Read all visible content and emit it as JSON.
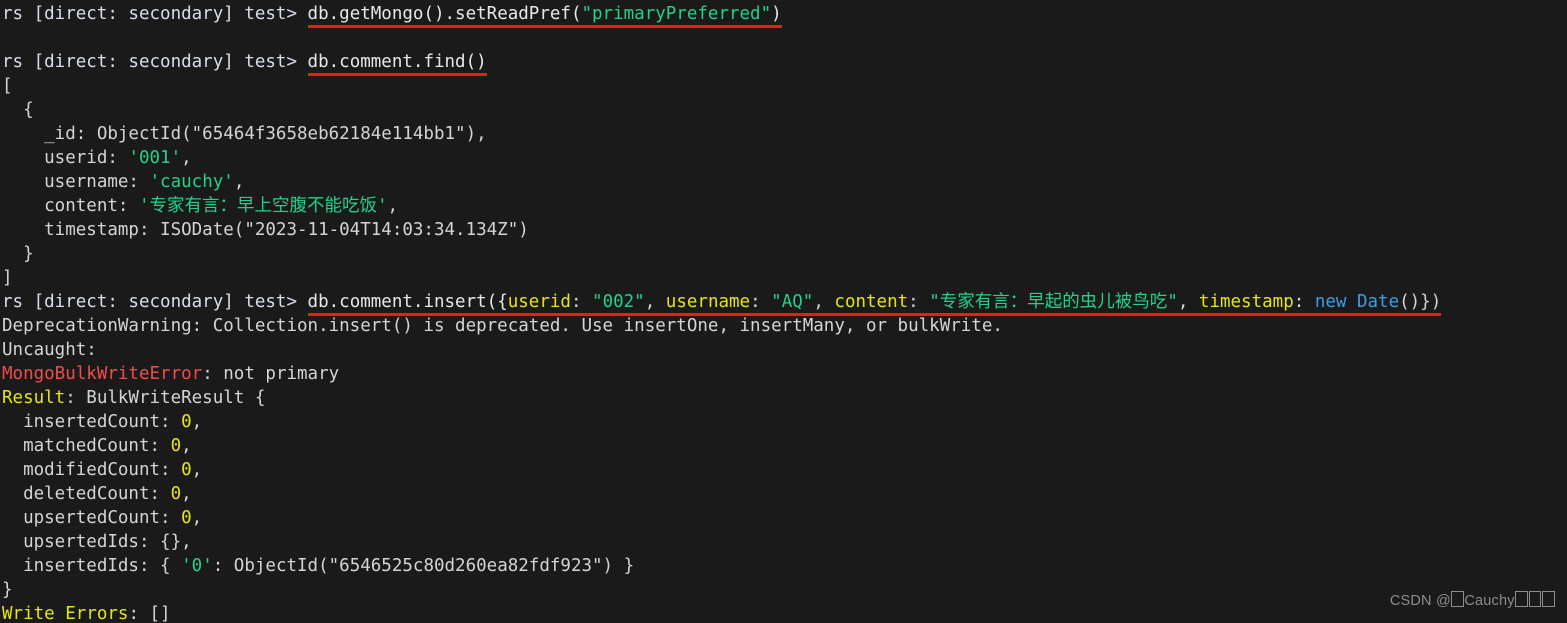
{
  "terminal": {
    "background_color": "#1a1a1a",
    "foreground_color": "#d4d4d4",
    "annotation_color": "#f01a1a",
    "prompt": "rs [direct: secondary] test> ",
    "lines": {
      "cmd1_prompt": "rs [direct: secondary] test> ",
      "cmd1_code_a": "db.getMongo().setReadPref(",
      "cmd1_code_str": "\"primaryPreferred\"",
      "cmd1_code_b": ")",
      "cmd2_prompt": "rs [direct: secondary] test> ",
      "cmd2_code": "db.comment.find()",
      "out_open_bracket": "[",
      "out_open_brace": "  {",
      "out_id_key": "    _id: ObjectId(\"65464f3658eb62184e114bb1\"),",
      "out_userid_key": "    userid: ",
      "out_userid_val": "'001'",
      "out_userid_tail": ",",
      "out_username_key": "    username: ",
      "out_username_val": "'cauchy'",
      "out_username_tail": ",",
      "out_content_key": "    content: ",
      "out_content_val": "'专家有言：早上空腹不能吃饭'",
      "out_content_tail": ",",
      "out_timestamp": "    timestamp: ISODate(\"2023-11-04T14:03:34.134Z\")",
      "out_close_brace": "  }",
      "out_close_bracket": "]",
      "cmd3_prompt": "rs [direct: secondary] test> ",
      "cmd3_fn": "db.comment.insert({",
      "cmd3_k1": "userid",
      "cmd3_sep1": ": ",
      "cmd3_v1": "\"002\"",
      "cmd3_c1": ", ",
      "cmd3_k2": "username",
      "cmd3_sep2": ": ",
      "cmd3_v2": "\"AQ\"",
      "cmd3_c2": ", ",
      "cmd3_k3": "content",
      "cmd3_sep3": ": ",
      "cmd3_v3": "\"专家有言：早起的虫儿被鸟吃\"",
      "cmd3_c3": ", ",
      "cmd3_k4": "timestamp",
      "cmd3_sep4": ": ",
      "cmd3_v4": "new Date",
      "cmd3_tail": "()})",
      "deprecation_warning": "DeprecationWarning: Collection.insert() is deprecated. Use insertOne, insertMany, or bulkWrite.",
      "uncaught": "Uncaught:",
      "error_name": "MongoBulkWriteError",
      "error_msg": ": not primary",
      "result_label": "Result",
      "result_rest": ": BulkWriteResult {",
      "inserted_count_key": "  insertedCount: ",
      "inserted_count_val": "0",
      "matched_count_key": "  matchedCount: ",
      "matched_count_val": "0",
      "modified_count_key": "  modifiedCount: ",
      "modified_count_val": "0",
      "deleted_count_key": "  deletedCount: ",
      "deleted_count_val": "0",
      "upserted_count_key": "  upsertedCount: ",
      "upserted_count_val": "0",
      "upserted_ids": "  upsertedIds: {},",
      "inserted_ids_key": "  insertedIds: { ",
      "inserted_ids_idx": "'0'",
      "inserted_ids_val": ": ObjectId(\"6546525c80d260ea82fdf923\") }",
      "result_close_brace": "}",
      "write_errors_label": "Write Errors",
      "write_errors_rest": ": []"
    }
  },
  "watermark": {
    "prefix": "CSDN @"
  }
}
